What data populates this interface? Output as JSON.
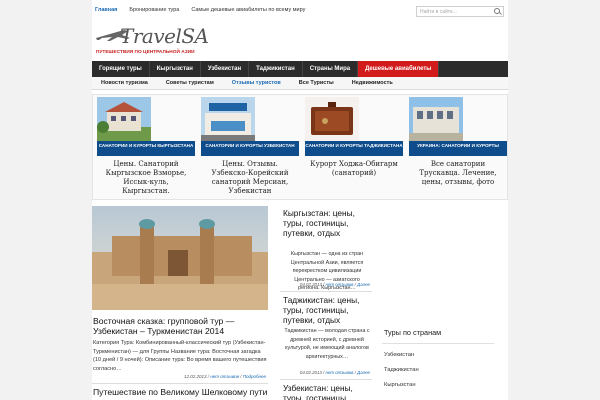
{
  "topbar": {
    "links": [
      "Главная",
      "Бронирование тура",
      "Самые дешевые авиабилеты по всему миру"
    ],
    "search_placeholder": "Найти в сайте..."
  },
  "logo": {
    "word": "TravelSA",
    "tagline": "ПУТЕШЕСТВИЯ ПО ЦЕНТРАЛЬНОЙ АЗИИ"
  },
  "main_nav": [
    "Горящие туры",
    "Кыргызстан",
    "Узбекистан",
    "Таджикистан",
    "Страны Мира",
    "Дешевые авиабилеты"
  ],
  "sub_nav": [
    "Новости туризма",
    "Советы туристам",
    "Отзывы туристов",
    "Все Туристы",
    "Недвижимость"
  ],
  "featured": [
    {
      "category": "САНАТОРИИ И КУРОРТЫ КЫРГЫЗСТАНА",
      "title": "Цены. Санаторий Кыргызское Взморье, Иссык-куль, Кыргызстан."
    },
    {
      "category": "САНАТОРИИ И КУРОРТЫ УЗБЕКИСТАН",
      "title": "Цены. Отзывы. Узбекско-Корейский санаторий Мерсиан, Узбекистан"
    },
    {
      "category": "САНАТОРИИ И КУРОРТЫ ТАДЖИКИСТАНА",
      "title": "Курорт Ходжа-Обигарм (санаторий)"
    },
    {
      "category": "УКРАИНА: САНАТОРИИ И КУРОРТЫ",
      "title": "Все санатории Трускавца. Лечение, цены, отзывы, фото"
    }
  ],
  "main_post": {
    "title": "Восточная сказка: групповой тур — Узбекистан – Туркменистан 2014",
    "excerpt": "Категория Тура: Комбинированный-классический тур (Узбекистан-Туркменистан) — для Группы Название тура: Восточная загадка (10 дней / 9 ночей): Описание тура: Во время вашего путешествия согласно…",
    "date": "12.02.2013",
    "comments": "нет отзывов",
    "more": "Подробнее"
  },
  "second_post": {
    "title": "Путешествие по Великому Шелковому пути"
  },
  "mid_posts": [
    {
      "title": "Кыргызстан: цены, туры, гостиницы, путевки, отдых",
      "excerpt": "Кыргызстан — одна из стран Центральной Азии, является перекрестком цивилизации Центрально — азиатского региона. Кыргызстан…",
      "date": "04.02.2013",
      "comments": "нет отзывов",
      "more": "Далее"
    },
    {
      "title": "Таджикистан: цены, туры, гостиницы, путевки, отдых",
      "excerpt": "Таджикистан — молодая страна с древней историей, с древней культурой, не имеющий аналогов архитектурных…",
      "date": "04.02.2013",
      "comments": "нет отзывов",
      "more": "Далее"
    },
    {
      "title": "Узбекистан: цены, туры, гостиницы,"
    }
  ],
  "sidebar": {
    "heading": "Туры по странам",
    "items": [
      "Узбекистан",
      "Таджикистан",
      "Кыргызстан"
    ]
  }
}
